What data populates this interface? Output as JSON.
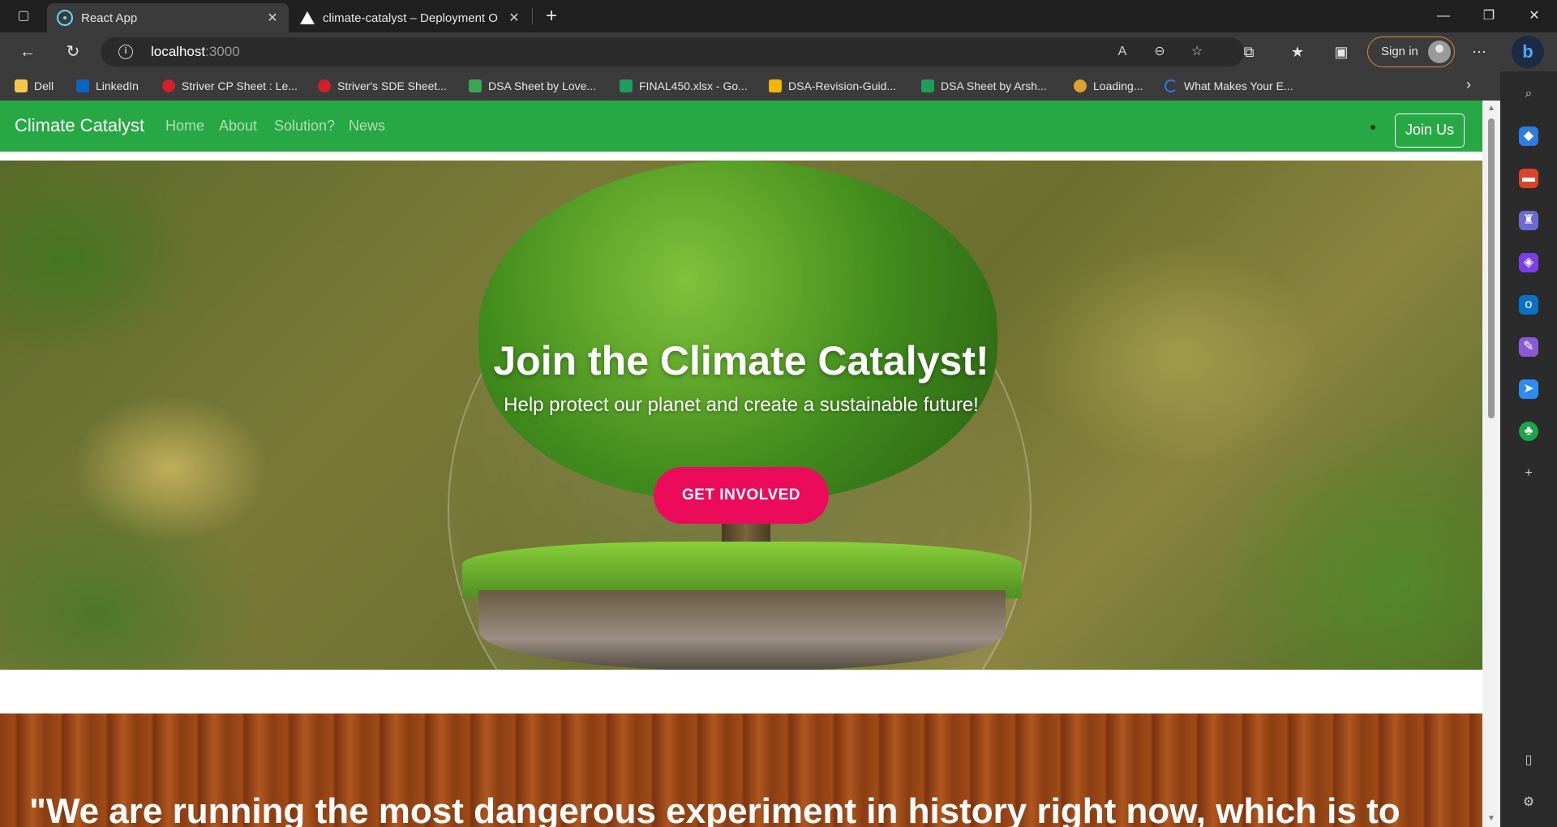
{
  "browser": {
    "tabs": [
      {
        "title": "React App",
        "active": true,
        "icon": "react-icon"
      },
      {
        "title": "climate-catalyst – Deployment O",
        "active": false,
        "icon": "vercel-icon"
      }
    ],
    "address": {
      "host": "localhost",
      "port": ":3000"
    },
    "sign_in_label": "Sign in",
    "bookmarks": [
      {
        "label": "Dell",
        "icon": "folder-icon",
        "color": "#f2c94c"
      },
      {
        "label": "LinkedIn",
        "icon": "linkedin-icon",
        "color": "#0a66c2"
      },
      {
        "label": "Striver CP Sheet : Le...",
        "icon": "tuf-icon",
        "color": "#d0202e"
      },
      {
        "label": "Striver's SDE Sheet...",
        "icon": "tuf-icon",
        "color": "#d0202e"
      },
      {
        "label": "DSA Sheet by Love...",
        "icon": "love-babbar-icon",
        "color": "#3aa655"
      },
      {
        "label": "FINAL450.xlsx - Go...",
        "icon": "sheets-icon",
        "color": "#1e9e5a"
      },
      {
        "label": "DSA-Revision-Guid...",
        "icon": "drive-icon",
        "color": "#f4b400"
      },
      {
        "label": "DSA Sheet by Arsh...",
        "icon": "sheets-icon",
        "color": "#1e9e5a"
      },
      {
        "label": "Loading...",
        "icon": "loading-icon",
        "color": "#e0a030"
      },
      {
        "label": "What Makes Your E...",
        "icon": "spinner-icon",
        "color": "#2d7de0"
      }
    ]
  },
  "site": {
    "brand": "Climate Catalyst",
    "nav": [
      "Home",
      "About",
      "Solution?",
      "News"
    ],
    "join_label": "Join Us",
    "hero": {
      "title": "Join the Climate Catalyst!",
      "subtitle": "Help protect our planet and create a sustainable future!",
      "cta": "GET INVOLVED"
    },
    "quote": "\"We are running the most dangerous experiment in history right now, which is to"
  },
  "colors": {
    "navbar": "#28a745",
    "cta": "#ec0a5a"
  }
}
